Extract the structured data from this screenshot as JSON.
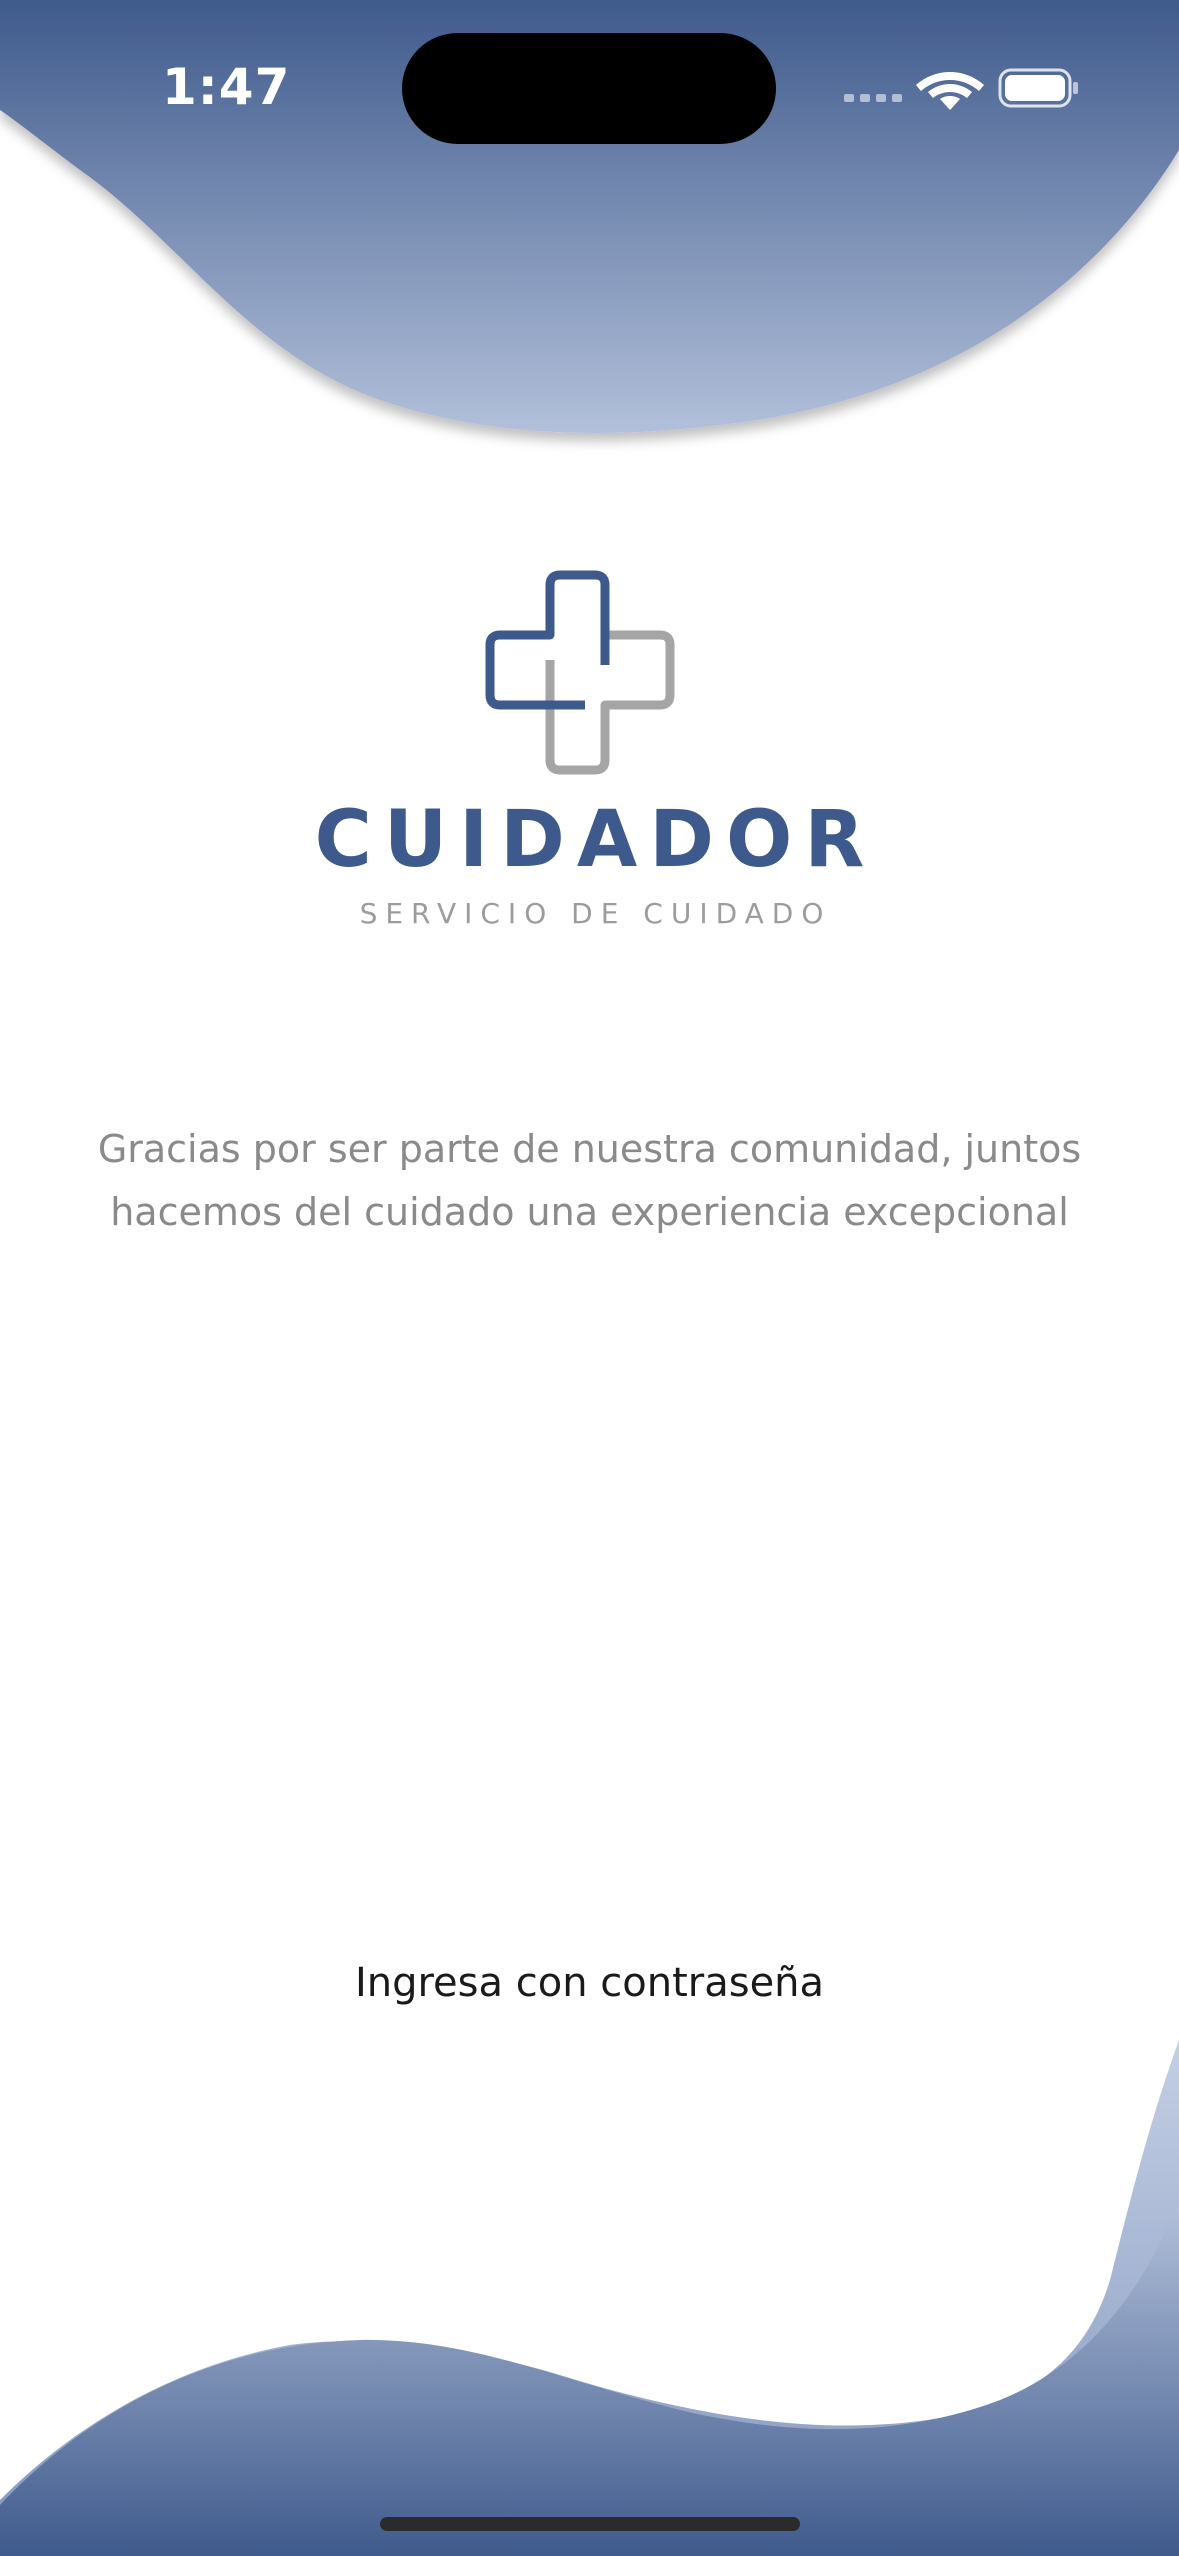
{
  "status_bar": {
    "time": "1:47",
    "icons": [
      "cellular-signal-icon",
      "wifi-icon",
      "battery-icon"
    ]
  },
  "brand": {
    "name": "CUIDADOR",
    "tagline": "SERVICIO DE CUIDADO",
    "logo": "medical-cross-logo",
    "primary_color": "#3e5a8c",
    "secondary_color": "#9c9c9c"
  },
  "welcome": {
    "line1": "Gracias por ser parte de nuestra comunidad, juntos",
    "line2": "hacemos del cuidado una experiencia excepcional"
  },
  "actions": {
    "login_label": "Ingresa con contraseña"
  },
  "theme": {
    "wave_top": "#3f5a8c",
    "wave_bottom": "#a9b8d4"
  }
}
